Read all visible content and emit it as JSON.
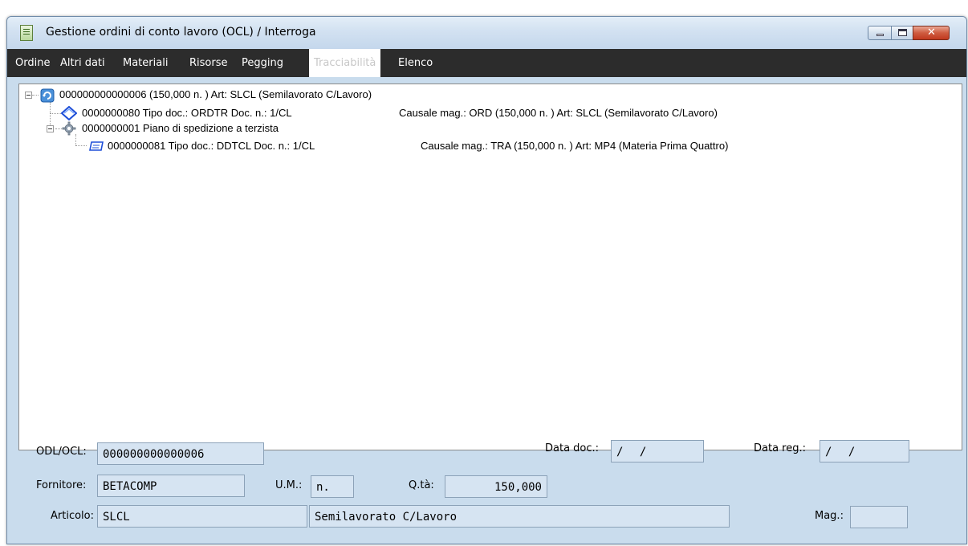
{
  "window": {
    "title": "Gestione ordini di conto lavoro (OCL) / Interroga",
    "close_glyph": "✕"
  },
  "tabs": [
    {
      "label": "Ordine",
      "active": false
    },
    {
      "label": "Altri dati",
      "active": false
    },
    {
      "label": "Materiali",
      "active": false
    },
    {
      "label": "Risorse",
      "active": false
    },
    {
      "label": "Pegging",
      "active": false
    },
    {
      "label": "Tracciabilità",
      "active": true
    },
    {
      "label": "Elenco",
      "active": false
    }
  ],
  "tree": {
    "root": {
      "icon": "order-refresh-icon",
      "text": "000000000000006 (150,000 n. ) Art: SLCL (Semilavorato C/Lavoro)"
    },
    "nodes": [
      {
        "icon": "blue-diamond-icon",
        "code": "0000000080 Tipo doc.: ORDTR Doc. n.: 1/CL",
        "detail": "Causale mag.: ORD   (150,000 n. ) Art: SLCL (Semilavorato C/Lavoro)"
      },
      {
        "icon": "gear-icon",
        "code": "0000000001 Piano di spedizione a terzista",
        "detail": ""
      },
      {
        "icon": "document-icon",
        "code": "0000000081 Tipo doc.: DDTCL Doc. n.: 1/CL",
        "detail": "Causale mag.: TRA   (150,000 n. ) Art: MP4 (Materia Prima Quattro)"
      }
    ]
  },
  "form": {
    "odl_label": "ODL/OCL:",
    "odl_value": "000000000000006",
    "data_doc_label": "Data doc.:",
    "data_doc_value": "/ /",
    "data_reg_label": "Data reg.:",
    "data_reg_value": "/ /",
    "fornitore_label": "Fornitore:",
    "fornitore_value": "BETACOMP",
    "um_label": "U.M.:",
    "um_value": "n.",
    "qta_label": "Q.tà:",
    "qta_value": "150,000",
    "articolo_label": "Articolo:",
    "articolo_value": "SLCL",
    "articolo_desc": "Semilavorato C/Lavoro",
    "mag_label": "Mag.:",
    "mag_value": ""
  }
}
